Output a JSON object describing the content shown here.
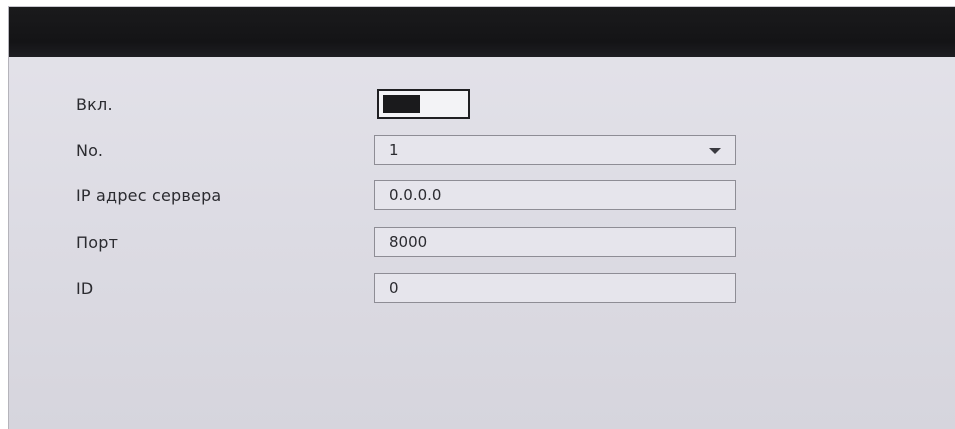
{
  "form": {
    "enable": {
      "label": "Вкл.",
      "checked": true
    },
    "number": {
      "label": "No.",
      "value": "1",
      "icon": "chevron-down-icon"
    },
    "server_ip": {
      "label": "IP адрес сервера",
      "value": "0.0.0.0"
    },
    "port": {
      "label": "Порт",
      "value": "8000"
    },
    "id": {
      "label": "ID",
      "value": "0"
    }
  },
  "colors": {
    "titlebar": "#141416",
    "panel_background": "#dedde5",
    "field_border": "#8e8d95",
    "text": "#2b2b30"
  }
}
